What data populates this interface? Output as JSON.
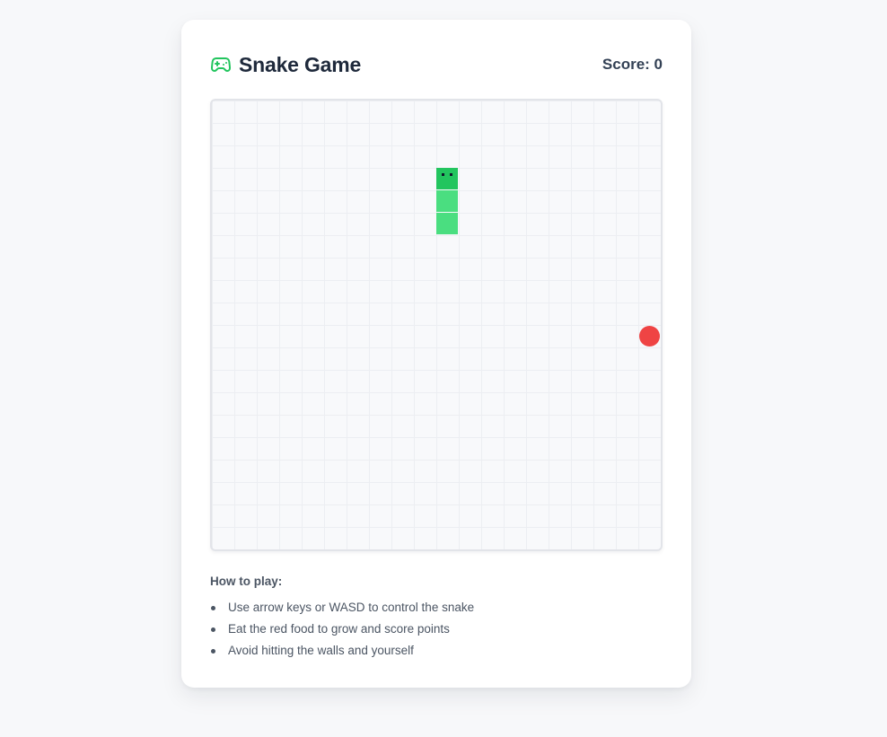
{
  "header": {
    "title": "Snake Game",
    "icon": "gamepad-icon",
    "icon_color": "#22c55e",
    "score_label": "Score: 0"
  },
  "board": {
    "grid_cols": 20,
    "grid_rows": 20,
    "snake": [
      {
        "col": 10,
        "row": 3,
        "head": true
      },
      {
        "col": 10,
        "row": 4,
        "head": false
      },
      {
        "col": 10,
        "row": 5,
        "head": false
      }
    ],
    "food": {
      "col": 19,
      "row": 10
    },
    "colors": {
      "snake_head": "#22c55e",
      "snake_body": "#4ade80",
      "food": "#ef4444",
      "grid_line": "#eceef2",
      "background": "#f8f9fb"
    }
  },
  "instructions": {
    "title": "How to play:",
    "items": [
      "Use arrow keys or WASD to control the snake",
      "Eat the red food to grow and score points",
      "Avoid hitting the walls and yourself"
    ]
  }
}
